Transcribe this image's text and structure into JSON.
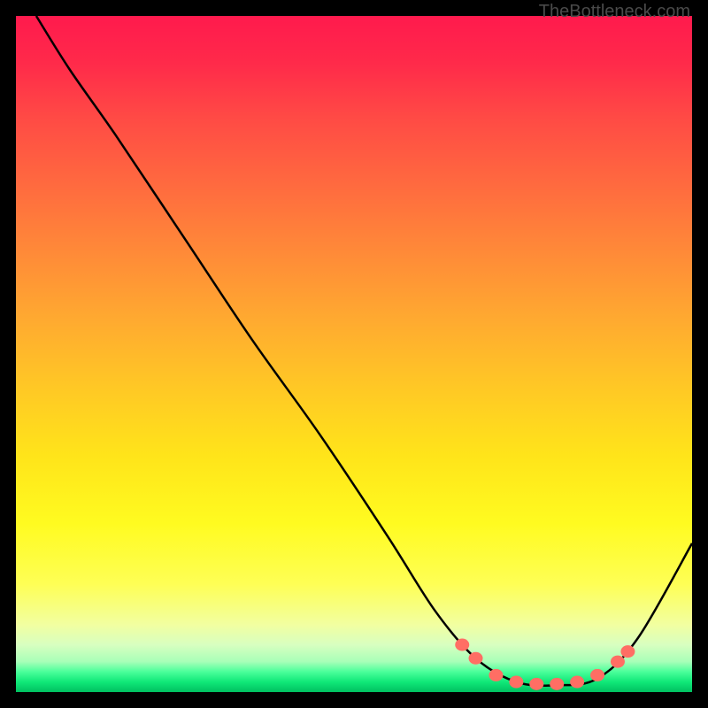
{
  "attribution": "TheBottleneck.com",
  "chart_data": {
    "type": "line",
    "title": "",
    "xlabel": "",
    "ylabel": "",
    "xlim": [
      0,
      100
    ],
    "ylim": [
      0,
      100
    ],
    "curve": [
      {
        "x": 3,
        "y": 100
      },
      {
        "x": 8,
        "y": 92
      },
      {
        "x": 15,
        "y": 82
      },
      {
        "x": 25,
        "y": 67
      },
      {
        "x": 35,
        "y": 52
      },
      {
        "x": 45,
        "y": 38
      },
      {
        "x": 55,
        "y": 23
      },
      {
        "x": 62,
        "y": 12
      },
      {
        "x": 68,
        "y": 5
      },
      {
        "x": 74,
        "y": 1.5
      },
      {
        "x": 80,
        "y": 1
      },
      {
        "x": 86,
        "y": 2
      },
      {
        "x": 92,
        "y": 8
      },
      {
        "x": 100,
        "y": 22
      }
    ],
    "markers": [
      {
        "x": 66,
        "y": 7
      },
      {
        "x": 68,
        "y": 5
      },
      {
        "x": 71,
        "y": 2.5
      },
      {
        "x": 74,
        "y": 1.5
      },
      {
        "x": 77,
        "y": 1.2
      },
      {
        "x": 80,
        "y": 1.2
      },
      {
        "x": 83,
        "y": 1.5
      },
      {
        "x": 86,
        "y": 2.5
      },
      {
        "x": 89,
        "y": 4.5
      },
      {
        "x": 90.5,
        "y": 6
      }
    ],
    "marker_color": "#ff6e64",
    "curve_color": "#000000"
  }
}
